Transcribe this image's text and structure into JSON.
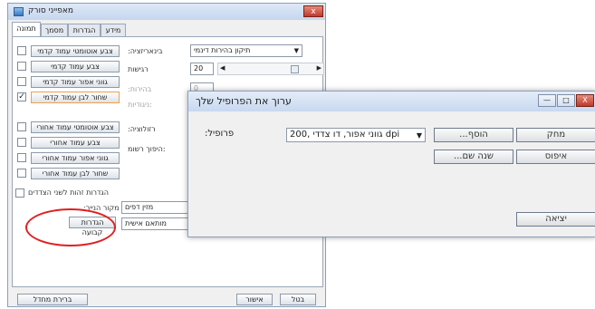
{
  "back_window": {
    "title": "מאפייני סורק",
    "close_label": "x",
    "tabs": [
      "תמונה",
      "מסמך",
      "הגדרות",
      "מידע"
    ],
    "image_types": [
      {
        "label": "צבע אוטומטי עמוד קדמי",
        "checked": false
      },
      {
        "label": "צבע עמוד קדמי",
        "checked": false
      },
      {
        "label": "גווני אפור עמוד קדמי",
        "checked": false
      },
      {
        "label": "שחור לבן עמוד קדמי",
        "checked": true
      },
      {
        "label": "צבע אוטומטי עמוד אחורי",
        "checked": false
      },
      {
        "label": "צבע עמוד אחורי",
        "checked": false
      },
      {
        "label": "גווני אפור עמוד אחורי",
        "checked": false
      },
      {
        "label": "שחור לבן עמוד אחורי",
        "checked": false
      }
    ],
    "binarization_label": ":בינאריזציה",
    "binarization_value": "תיקון בהירות דינמי",
    "sensitivity_label": "רגישות",
    "sensitivity_value": "20",
    "brightness_label": ":בהירות",
    "brightness_value": "0",
    "contrast_label": "ניגודיות:",
    "resolution_label": ":רזולוציה",
    "reverse_label": "היפוך רשומ:",
    "merge_label": "הגדרות זהות לשני הצדדים",
    "paper_source_label": ":מקור הנייר",
    "paper_source_value": "מזין דפים",
    "profile_value": "מותאם אישית",
    "fixed_settings_label": "הגדרות קבועה",
    "default_button": "ברירת מחדל",
    "ok_button": "אישור",
    "cancel_button": "בטל"
  },
  "front_window": {
    "title": "ערוך את הפרופיל שלך",
    "minimize_label": "—",
    "maximize_label": "□",
    "close_label": "X",
    "profile_label": ":פרופיל",
    "profile_value": "גווני אפור, דו צדדי ,200 dpi",
    "add_button": "...הוסף",
    "rename_button": "...שנה שם",
    "delete_button": "מחק",
    "reset_button": "איפוס",
    "exit_button": "יציאה"
  },
  "colors": {
    "title_gradient_top": "#dfe9f7",
    "close_red": "#c0392b",
    "annotation_circle": "#e02020",
    "selected_button_border": "#f0a04a"
  }
}
